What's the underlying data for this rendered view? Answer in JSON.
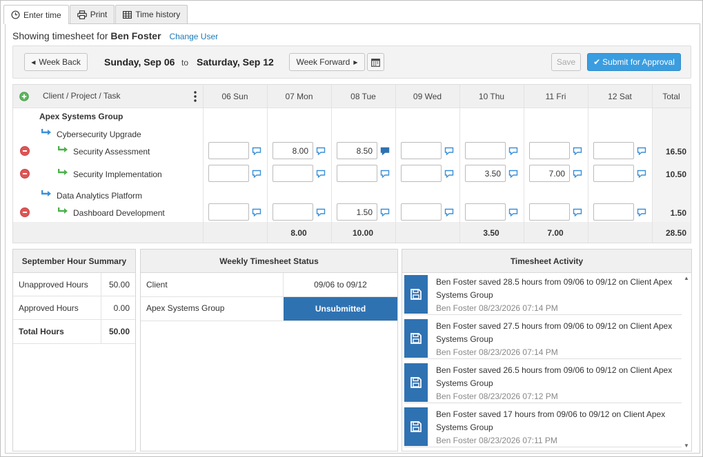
{
  "tabs": [
    {
      "label": "Enter time"
    },
    {
      "label": "Print"
    },
    {
      "label": "Time history"
    }
  ],
  "header": {
    "showing_prefix": "Showing timesheet for",
    "user": "Ben Foster",
    "change_user": "Change User"
  },
  "toolbar": {
    "week_back": "Week Back",
    "week_start": "Sunday, Sep 06",
    "to": "to",
    "week_end": "Saturday, Sep 12",
    "week_forward": "Week Forward",
    "save": "Save",
    "submit": "Submit for Approval"
  },
  "grid": {
    "task_header": "Client / Project / Task",
    "days": [
      "06 Sun",
      "07 Mon",
      "08 Tue",
      "09 Wed",
      "10 Thu",
      "11 Fri",
      "12 Sat"
    ],
    "total_header": "Total",
    "client": "Apex Systems Group",
    "projects": [
      {
        "name": "Cybersecurity Upgrade",
        "tasks": [
          {
            "name": "Security Assessment",
            "values": [
              "",
              "8.00",
              "8.50",
              "",
              "",
              "",
              ""
            ],
            "total": "16.50"
          },
          {
            "name": "Security Implementation",
            "values": [
              "",
              "",
              "",
              "",
              "3.50",
              "7.00",
              ""
            ],
            "total": "10.50"
          }
        ]
      },
      {
        "name": "Data Analytics Platform",
        "tasks": [
          {
            "name": "Dashboard Development",
            "values": [
              "",
              "",
              "1.50",
              "",
              "",
              "",
              ""
            ],
            "total": "1.50"
          }
        ]
      }
    ],
    "day_totals": [
      "",
      "8.00",
      "10.00",
      "",
      "3.50",
      "7.00",
      ""
    ],
    "grand_total": "28.50"
  },
  "summary": {
    "title": "September Hour Summary",
    "rows": [
      {
        "label": "Unapproved Hours",
        "value": "50.00"
      },
      {
        "label": "Approved Hours",
        "value": "0.00"
      },
      {
        "label": "Total Hours",
        "value": "50.00"
      }
    ]
  },
  "status": {
    "title": "Weekly Timesheet Status",
    "col1": "Client",
    "col2": "09/06 to 09/12",
    "client": "Apex Systems Group",
    "state": "Unsubmitted"
  },
  "activity": {
    "title": "Timesheet Activity",
    "items": [
      {
        "text": "Ben Foster saved 28.5 hours from 09/06 to 09/12 on Client Apex Systems Group",
        "meta": "Ben Foster 08/23/2026 07:14 PM"
      },
      {
        "text": "Ben Foster saved 27.5 hours from 09/06 to 09/12 on Client Apex Systems Group",
        "meta": "Ben Foster 08/23/2026 07:14 PM"
      },
      {
        "text": "Ben Foster saved 26.5 hours from 09/06 to 09/12 on Client Apex Systems Group",
        "meta": "Ben Foster 08/23/2026 07:12 PM"
      },
      {
        "text": "Ben Foster saved 17 hours from 09/06 to 09/12 on Client Apex Systems Group",
        "meta": "Ben Foster 08/23/2026 07:11 PM"
      }
    ]
  },
  "colors": {
    "primary": "#3a9de0",
    "status_badge": "#2f72b2",
    "remove": "#e05555",
    "add": "#5cb85c"
  }
}
